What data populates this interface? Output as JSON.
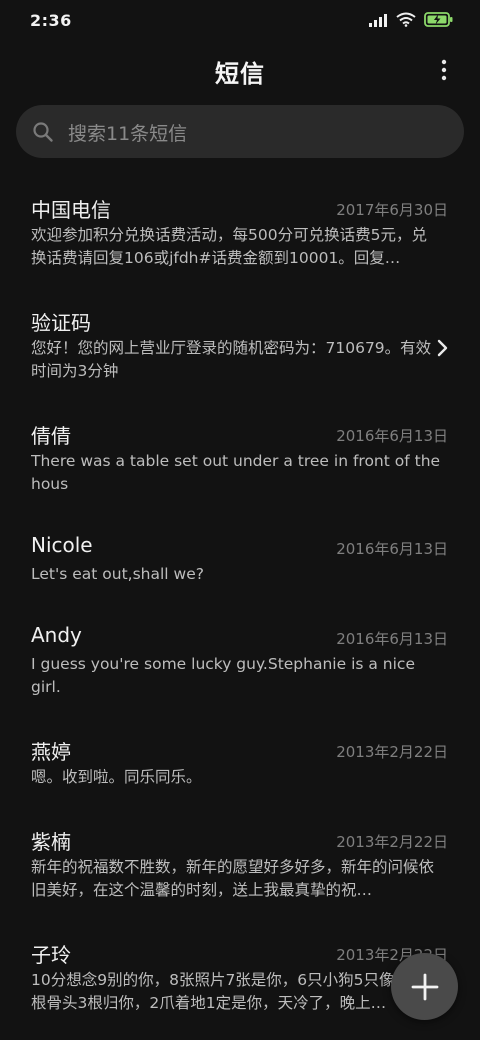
{
  "status_bar": {
    "time": "2:36",
    "icons": [
      "signal-icon",
      "wifi-icon",
      "battery-charging-icon"
    ]
  },
  "header": {
    "title": "短信",
    "more_icon": "more-vertical-icon"
  },
  "search": {
    "placeholder": "搜索11条短信",
    "icon": "search-icon"
  },
  "messages": [
    {
      "sender": "中国电信",
      "date": "2017年6月30日",
      "preview": "欢迎参加积分兑换话费活动，每500分可兑换话费5元，兑换话费请回复106或jfdh#话费金额到10001。回复…"
    },
    {
      "sender": "验证码",
      "date": "",
      "preview": "您好！您的网上营业厅登录的随机密码为：710679。有效时间为3分钟",
      "has_chevron": true
    },
    {
      "sender": "倩倩",
      "date": "2016年6月13日",
      "preview": "There was a table set out under a tree in front of the hous"
    },
    {
      "sender": "Nicole",
      "date": "2016年6月13日",
      "preview": "Let's eat out,shall we?"
    },
    {
      "sender": "Andy",
      "date": "2016年6月13日",
      "preview": "I guess you're some lucky guy.Stephanie is a nice girl."
    },
    {
      "sender": "燕婷",
      "date": "2013年2月22日",
      "preview": "嗯。收到啦。同乐同乐。"
    },
    {
      "sender": "紫楠",
      "date": "2013年2月22日",
      "preview": "新年的祝福数不胜数，新年的愿望好多好多，新年的问候依旧美好，在这个温馨的时刻，送上我最真挚的祝…"
    },
    {
      "sender": "子玲",
      "date": "2013年2月22日",
      "preview": "10分想念9别的你，8张照片7张是你，6只小狗5只像你，4根骨头3根归你，2爪着地1定是你，天冷了，晚上…"
    }
  ],
  "fab": {
    "icon": "plus-icon"
  },
  "colors": {
    "background": "#121212",
    "search_bg": "#2a2a2a",
    "fab_bg": "#4a4a4a",
    "date_text": "#7f7f7f"
  }
}
